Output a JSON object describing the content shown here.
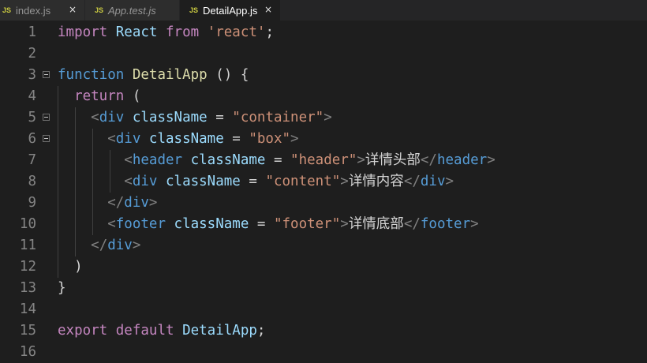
{
  "tabs": [
    {
      "badge": "JS",
      "label": "index.js",
      "close": "×",
      "active": false,
      "italic": false
    },
    {
      "badge": "JS",
      "label": "App.test.js",
      "active": false,
      "italic": true
    },
    {
      "badge": "JS",
      "label": "DetailApp.js",
      "close": "×",
      "active": true,
      "italic": false
    }
  ],
  "lines": [
    {
      "n": "1",
      "t": [
        [
          "kw",
          "import"
        ],
        [
          "op",
          " "
        ],
        [
          "var",
          "React"
        ],
        [
          "op",
          " "
        ],
        [
          "kw",
          "from"
        ],
        [
          "op",
          " "
        ],
        [
          "str",
          "'react'"
        ],
        [
          "op",
          ";"
        ]
      ]
    },
    {
      "n": "2",
      "t": []
    },
    {
      "n": "3",
      "t": [
        [
          "blue",
          "function"
        ],
        [
          "op",
          " "
        ],
        [
          "fn",
          "DetailApp"
        ],
        [
          "op",
          " () {"
        ]
      ]
    },
    {
      "n": "4",
      "t": [
        [
          "op",
          "  "
        ],
        [
          "kw",
          "return"
        ],
        [
          "op",
          " ("
        ]
      ]
    },
    {
      "n": "5",
      "t": [
        [
          "op",
          "    "
        ],
        [
          "br",
          "<"
        ],
        [
          "tag",
          "div"
        ],
        [
          "op",
          " "
        ],
        [
          "var",
          "className"
        ],
        [
          "op",
          " = "
        ],
        [
          "str",
          "\"container\""
        ],
        [
          "br",
          ">"
        ]
      ]
    },
    {
      "n": "6",
      "t": [
        [
          "op",
          "      "
        ],
        [
          "br",
          "<"
        ],
        [
          "tag",
          "div"
        ],
        [
          "op",
          " "
        ],
        [
          "var",
          "className"
        ],
        [
          "op",
          " = "
        ],
        [
          "str",
          "\"box\""
        ],
        [
          "br",
          ">"
        ]
      ]
    },
    {
      "n": "7",
      "t": [
        [
          "op",
          "        "
        ],
        [
          "br",
          "<"
        ],
        [
          "tag",
          "header"
        ],
        [
          "op",
          " "
        ],
        [
          "var",
          "className"
        ],
        [
          "op",
          " = "
        ],
        [
          "str",
          "\"header\""
        ],
        [
          "br",
          ">"
        ],
        [
          "cjk",
          "详情头部"
        ],
        [
          "br",
          "</"
        ],
        [
          "tag",
          "header"
        ],
        [
          "br",
          ">"
        ]
      ]
    },
    {
      "n": "8",
      "t": [
        [
          "op",
          "        "
        ],
        [
          "br",
          "<"
        ],
        [
          "tag",
          "div"
        ],
        [
          "op",
          " "
        ],
        [
          "var",
          "className"
        ],
        [
          "op",
          " = "
        ],
        [
          "str",
          "\"content\""
        ],
        [
          "br",
          ">"
        ],
        [
          "cjk",
          "详情内容"
        ],
        [
          "br",
          "</"
        ],
        [
          "tag",
          "div"
        ],
        [
          "br",
          ">"
        ]
      ]
    },
    {
      "n": "9",
      "t": [
        [
          "op",
          "      "
        ],
        [
          "br",
          "</"
        ],
        [
          "tag",
          "div"
        ],
        [
          "br",
          ">"
        ]
      ]
    },
    {
      "n": "10",
      "t": [
        [
          "op",
          "      "
        ],
        [
          "br",
          "<"
        ],
        [
          "tag",
          "footer"
        ],
        [
          "op",
          " "
        ],
        [
          "var",
          "className"
        ],
        [
          "op",
          " = "
        ],
        [
          "str",
          "\"footer\""
        ],
        [
          "br",
          ">"
        ],
        [
          "cjk",
          "详情底部"
        ],
        [
          "br",
          "</"
        ],
        [
          "tag",
          "footer"
        ],
        [
          "br",
          ">"
        ]
      ]
    },
    {
      "n": "11",
      "t": [
        [
          "op",
          "    "
        ],
        [
          "br",
          "</"
        ],
        [
          "tag",
          "div"
        ],
        [
          "br",
          ">"
        ]
      ]
    },
    {
      "n": "12",
      "t": [
        [
          "op",
          "  )"
        ]
      ]
    },
    {
      "n": "13",
      "t": [
        [
          "op",
          "}"
        ]
      ]
    },
    {
      "n": "14",
      "t": []
    },
    {
      "n": "15",
      "t": [
        [
          "kw",
          "export"
        ],
        [
          "op",
          " "
        ],
        [
          "kw",
          "default"
        ],
        [
          "op",
          " "
        ],
        [
          "var",
          "DetailApp"
        ],
        [
          "op",
          ";"
        ]
      ]
    },
    {
      "n": "16",
      "t": []
    }
  ],
  "fold_lines": [
    "3",
    "5",
    "6"
  ]
}
